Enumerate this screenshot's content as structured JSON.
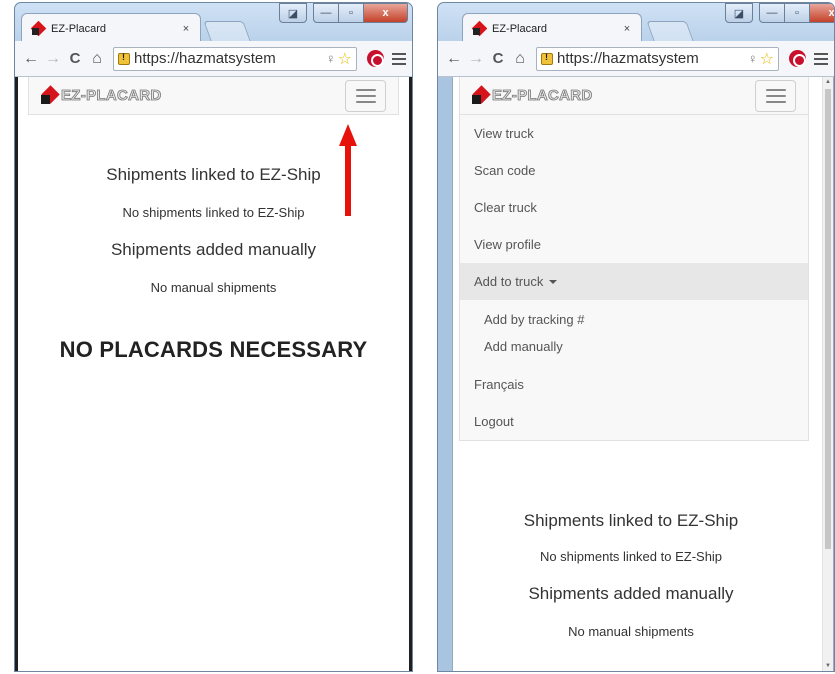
{
  "window_left": {
    "tab_title": "EZ-Placard",
    "tab_close": "×",
    "url": "https://hazmatsystem",
    "brand": "EZ-PLACARD",
    "shipments_ezship_heading": "Shipments linked to EZ-Ship",
    "shipments_ezship_empty": "No shipments linked to EZ-Ship",
    "shipments_manual_heading": "Shipments added manually",
    "shipments_manual_empty": "No manual shipments",
    "placard_status": "NO PLACARDS NECESSARY"
  },
  "window_right": {
    "tab_title": "EZ-Placard",
    "tab_close": "×",
    "url": "https://hazmatsystem",
    "brand": "EZ-PLACARD",
    "menu": {
      "view_truck": "View truck",
      "scan_code": "Scan code",
      "clear_truck": "Clear truck",
      "view_profile": "View profile",
      "add_to_truck": "Add to truck",
      "add_by_tracking": "Add by tracking #",
      "add_manually": "Add manually",
      "language": "Français",
      "logout": "Logout"
    },
    "shipments_ezship_heading": "Shipments linked to EZ-Ship",
    "shipments_ezship_empty": "No shipments linked to EZ-Ship",
    "shipments_manual_heading": "Shipments added manually",
    "shipments_manual_empty": "No manual shipments"
  },
  "icons": {
    "back": "←",
    "forward": "→",
    "reload": "C",
    "home": "⌂",
    "key": "♀",
    "star": "☆",
    "minimize": "—",
    "maximize": "▫",
    "close": "x",
    "small": "◪"
  },
  "colors": {
    "annotation_arrow": "#e8120c",
    "logo_red": "#d6141c",
    "menu_active_bg": "#e7e7e7"
  }
}
